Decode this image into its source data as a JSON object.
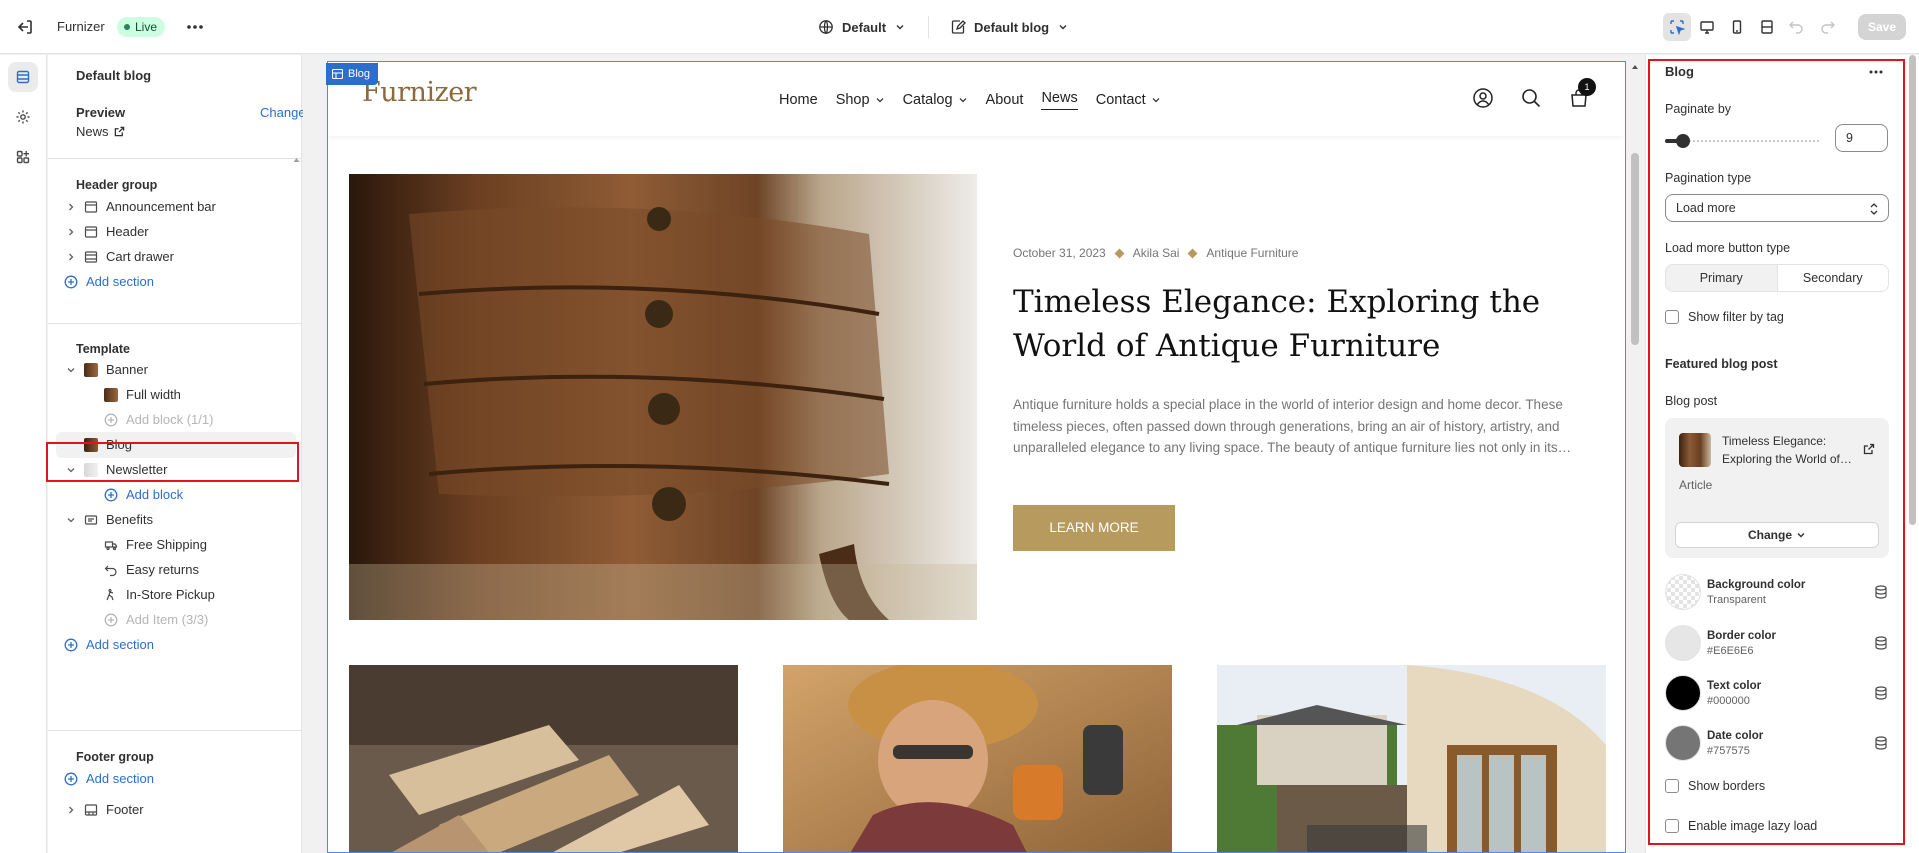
{
  "topbar": {
    "store_name": "Furnizer",
    "status": "Live",
    "theme_name": "Default",
    "page_name": "Default blog",
    "save_label": "Save"
  },
  "sidebar": {
    "title": "Default blog",
    "preview_label": "Preview",
    "change_label": "Change",
    "preview_page": "News",
    "header_group": {
      "label": "Header group",
      "items": [
        "Announcement bar",
        "Header",
        "Cart drawer"
      ],
      "add_label": "Add section"
    },
    "template": {
      "label": "Template",
      "banner": "Banner",
      "banner_block": "Full width",
      "banner_add": "Add block (1/1)",
      "blog": "Blog",
      "newsletter": "Newsletter",
      "newsletter_add": "Add block",
      "benefits": "Benefits",
      "benefit_items": [
        "Free Shipping",
        "Easy returns",
        "In-Store Pickup"
      ],
      "benefits_add": "Add Item (3/3)",
      "add_label": "Add section"
    },
    "footer_group": {
      "label": "Footer group",
      "add_label": "Add section",
      "footer": "Footer"
    }
  },
  "preview": {
    "section_tag": "Blog",
    "logo": "Furnizer",
    "nav": [
      "Home",
      "Shop",
      "Catalog",
      "About",
      "News",
      "Contact"
    ],
    "cart_count": "1",
    "post": {
      "date": "October 31, 2023",
      "author": "Akila Sai",
      "category": "Antique Furniture",
      "title": "Timeless Elegance: Exploring the World of Antique Furniture",
      "excerpt": "Antique furniture holds a special place in the world of interior design and home decor. These timeless pieces, often passed down through generations, bring an air of history, artistry, and unparalleled elegance to any living space. The beauty of antique furniture lies not only in its…",
      "button": "LEARN MORE"
    }
  },
  "panel": {
    "title": "Blog",
    "paginate_label": "Paginate by",
    "paginate_value": "9",
    "paginate_fraction": 0.12,
    "pagination_type_label": "Pagination type",
    "pagination_type_value": "Load more",
    "load_more_label": "Load more button type",
    "load_more_options": [
      "Primary",
      "Secondary"
    ],
    "show_filter_label": "Show filter by tag",
    "featured_heading": "Featured blog post",
    "blog_post_label": "Blog post",
    "blog_post_title": "Timeless Elegance: Exploring the World of…",
    "blog_post_type": "Article",
    "change_label": "Change",
    "colors": [
      {
        "name": "Background color",
        "value": "Transparent",
        "hex": "transparent"
      },
      {
        "name": "Border color",
        "value": "#E6E6E6",
        "hex": "#E6E6E6"
      },
      {
        "name": "Text color",
        "value": "#000000",
        "hex": "#000000"
      },
      {
        "name": "Date color",
        "value": "#757575",
        "hex": "#757575"
      }
    ],
    "show_borders_label": "Show borders",
    "lazy_load_label": "Enable image lazy load"
  }
}
